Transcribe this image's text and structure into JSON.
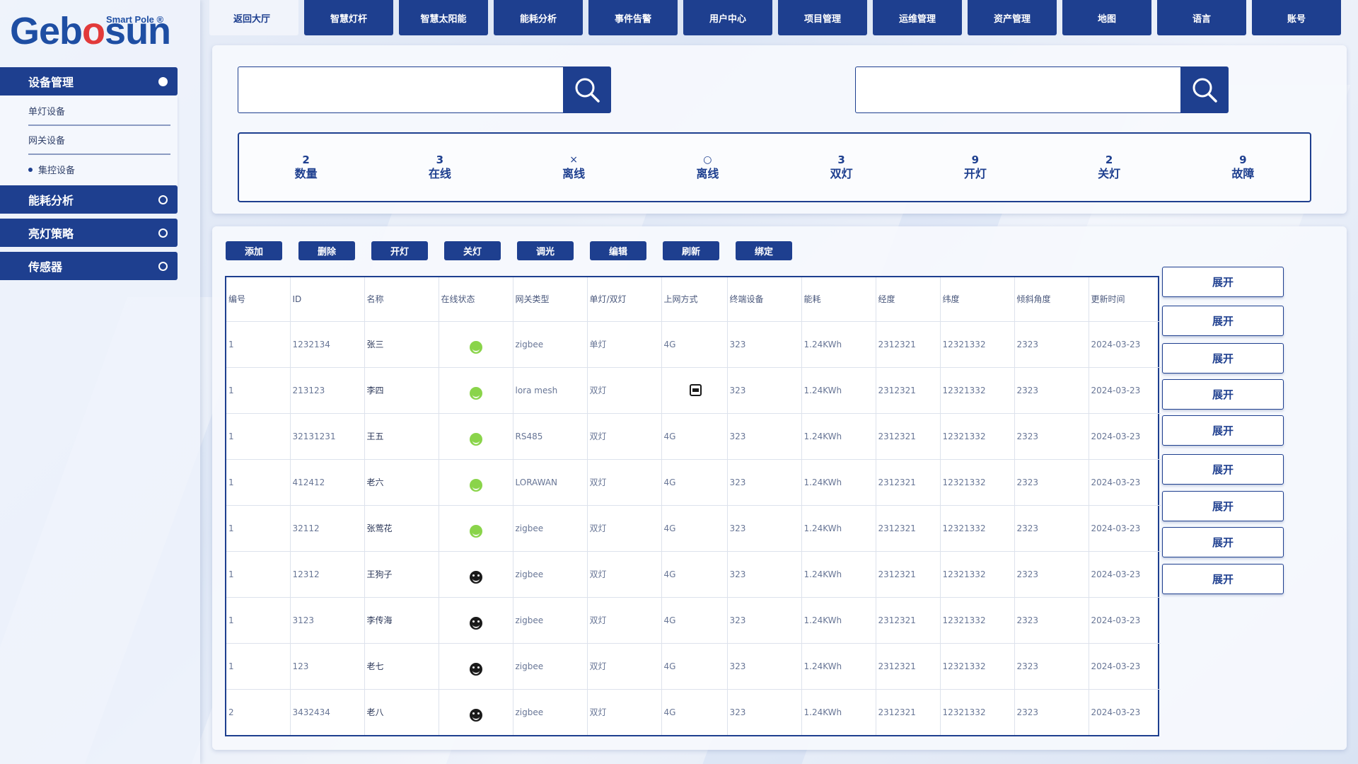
{
  "brand": {
    "name_pre": "Geb",
    "name_o": "o",
    "name_post": "sun",
    "tagline": "Smart Pole",
    "reg": "®"
  },
  "sidebar": {
    "groups": [
      {
        "label": "设备管理",
        "expanded": true,
        "sub": [
          "单灯设备",
          "网关设备",
          "集控设备"
        ]
      },
      {
        "label": "能耗分析"
      },
      {
        "label": "亮灯策略"
      },
      {
        "label": "传感器"
      }
    ]
  },
  "topnav": {
    "tabs": [
      "返回大厅",
      "智慧灯杆",
      "智慧太阳能",
      "能耗分析",
      "事件告警",
      "用户中心",
      "项目管理",
      "运维管理",
      "资产管理",
      "地图",
      "语言",
      "账号"
    ]
  },
  "search": {
    "left": {
      "value": "",
      "placeholder": ""
    },
    "right": {
      "value": "",
      "placeholder": ""
    }
  },
  "stats": [
    {
      "value": "2",
      "label": "数量"
    },
    {
      "value": "3",
      "label": "在线"
    },
    {
      "value": "×",
      "label": "离线"
    },
    {
      "value": "○",
      "label": "离线"
    },
    {
      "value": "3",
      "label": "双灯"
    },
    {
      "value": "9",
      "label": "开灯"
    },
    {
      "value": "2",
      "label": "关灯"
    },
    {
      "value": "9",
      "label": "故障"
    }
  ],
  "toolbar": [
    "添加",
    "删除",
    "开灯",
    "关灯",
    "调光",
    "编辑",
    "刷新",
    "绑定"
  ],
  "table": {
    "columns": [
      "编号",
      "ID",
      "名称",
      "在线状态",
      "网关类型",
      "单灯/双灯",
      "上网方式",
      "终端设备",
      "能耗",
      "经度",
      "纬度",
      "倾斜角度",
      "更新时间"
    ],
    "rows": [
      {
        "no": "1",
        "id": "1232134",
        "name": "张三",
        "state": "online",
        "gateway": "zigbee",
        "lamp": "单灯",
        "net": "4G",
        "terminal": "323",
        "energy": "1.24KWh",
        "lng": "2312321",
        "lat": "12321332",
        "tilt": "2323",
        "updated": "2024-03-23"
      },
      {
        "no": "1",
        "id": "213123",
        "name": "李四",
        "state": "online",
        "gateway": "lora mesh",
        "lamp": "双灯",
        "net": "",
        "terminal": "323",
        "energy": "1.24KWh",
        "lng": "2312321",
        "lat": "12321332",
        "tilt": "2323",
        "updated": "2024-03-23"
      },
      {
        "no": "1",
        "id": "32131231",
        "name": "王五",
        "state": "online",
        "gateway": "RS485",
        "lamp": "双灯",
        "net": "4G",
        "terminal": "323",
        "energy": "1.24KWh",
        "lng": "2312321",
        "lat": "12321332",
        "tilt": "2323",
        "updated": "2024-03-23"
      },
      {
        "no": "1",
        "id": "412412",
        "name": "老六",
        "state": "online",
        "gateway": "LORAWAN",
        "lamp": "双灯",
        "net": "4G",
        "terminal": "323",
        "energy": "1.24KWh",
        "lng": "2312321",
        "lat": "12321332",
        "tilt": "2323",
        "updated": "2024-03-23"
      },
      {
        "no": "1",
        "id": "32112",
        "name": "张莺花",
        "state": "online",
        "gateway": "zigbee",
        "lamp": "双灯",
        "net": "4G",
        "terminal": "323",
        "energy": "1.24KWh",
        "lng": "2312321",
        "lat": "12321332",
        "tilt": "2323",
        "updated": "2024-03-23"
      },
      {
        "no": "1",
        "id": "12312",
        "name": "王狗子",
        "state": "offline",
        "gateway": "zigbee",
        "lamp": "双灯",
        "net": "4G",
        "terminal": "323",
        "energy": "1.24KWh",
        "lng": "2312321",
        "lat": "12321332",
        "tilt": "2323",
        "updated": "2024-03-23"
      },
      {
        "no": "1",
        "id": "3123",
        "name": "李传海",
        "state": "offline",
        "gateway": "zigbee",
        "lamp": "双灯",
        "net": "4G",
        "terminal": "323",
        "energy": "1.24KWh",
        "lng": "2312321",
        "lat": "12321332",
        "tilt": "2323",
        "updated": "2024-03-23"
      },
      {
        "no": "1",
        "id": "123",
        "name": "老七",
        "state": "offline",
        "gateway": "zigbee",
        "lamp": "双灯",
        "net": "4G",
        "terminal": "323",
        "energy": "1.24KWh",
        "lng": "2312321",
        "lat": "12321332",
        "tilt": "2323",
        "updated": "2024-03-23"
      },
      {
        "no": "2",
        "id": "3432434",
        "name": "老八",
        "state": "offline",
        "gateway": "zigbee",
        "lamp": "双灯",
        "net": "4G",
        "terminal": "323",
        "energy": "1.24KWh",
        "lng": "2312321",
        "lat": "12321332",
        "tilt": "2323",
        "updated": "2024-03-23"
      }
    ],
    "expand_label": "展开"
  },
  "colors": {
    "primary": "#1e3f8f",
    "online": "#8ad44a",
    "offline": "#1a1a1a",
    "brand_accent": "#e23a3a"
  },
  "icons": {
    "search": "search-icon",
    "online": "smiley-online-icon",
    "offline": "smiley-offline-icon",
    "doc": "document-icon"
  }
}
